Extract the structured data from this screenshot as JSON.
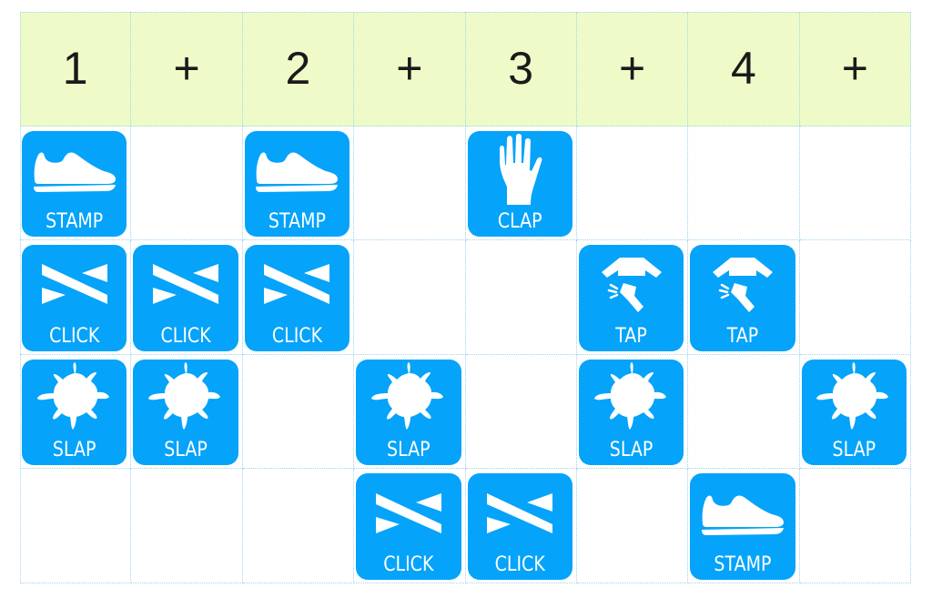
{
  "header": [
    "1",
    "+",
    "2",
    "+",
    "3",
    "+",
    "4",
    "+"
  ],
  "colors": {
    "tile": "#05a3fa",
    "header_bg": "#eefbc8",
    "grid_line": "#9fd3ef"
  },
  "sounds": {
    "stamp": {
      "label": "STAMP",
      "icon": "shoe-icon"
    },
    "clap": {
      "label": "CLAP",
      "icon": "hand-icon"
    },
    "click": {
      "label": "CLICK",
      "icon": "click-icon"
    },
    "tap": {
      "label": "TAP",
      "icon": "tap-icon"
    },
    "slap": {
      "label": "SLAP",
      "icon": "splat-icon"
    }
  },
  "rows": [
    [
      "stamp",
      "",
      "stamp",
      "",
      "clap",
      "",
      "",
      ""
    ],
    [
      "click",
      "click",
      "click",
      "",
      "",
      "tap",
      "tap",
      ""
    ],
    [
      "slap",
      "slap",
      "",
      "slap",
      "",
      "slap",
      "",
      "slap"
    ],
    [
      "",
      "",
      "",
      "click",
      "click",
      "",
      "stamp",
      ""
    ]
  ]
}
